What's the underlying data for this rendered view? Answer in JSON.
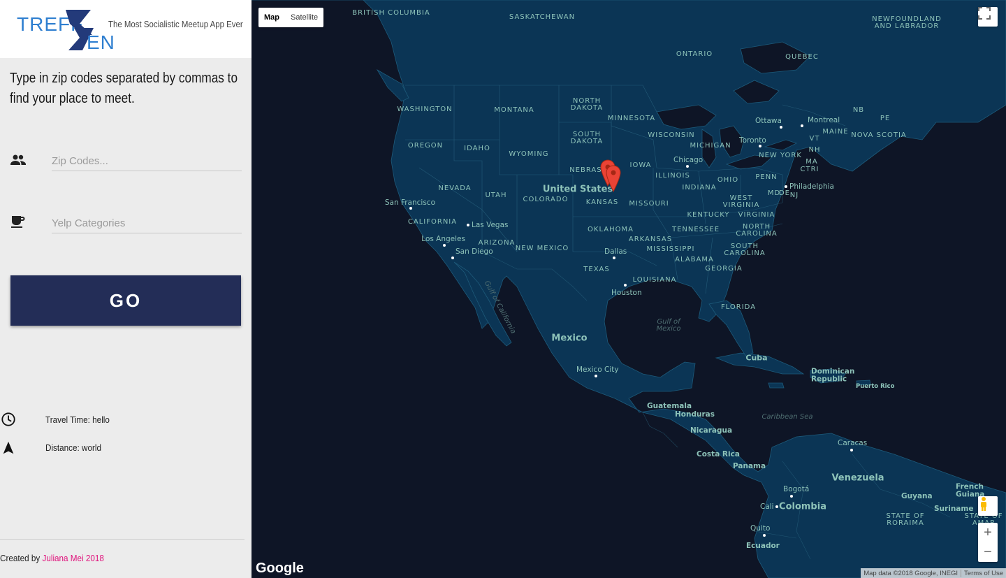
{
  "app": {
    "logo_text_top": "TREFF",
    "logo_text_bottom": "EN",
    "tagline": "The Most Socialistic Meetup App Ever"
  },
  "intro": "Type in zip codes separated by commas to find your place to meet.",
  "inputs": {
    "zip_placeholder": "Zip Codes...",
    "yelp_placeholder": "Yelp Categories"
  },
  "go_label": "GO",
  "stats": {
    "travel_time": "Travel Time: hello",
    "distance": "Distance: world"
  },
  "footer": {
    "prefix": "Created by ",
    "author": "Juliana Mei 2018"
  },
  "map": {
    "type_buttons": [
      "Map",
      "Satellite"
    ],
    "labels": {
      "countries": [
        "United States",
        "Mexico",
        "Cuba",
        "Venezuela",
        "Colombia"
      ],
      "regions": [
        "BRITISH COLUMBIA",
        "SASKATCHEWAN",
        "NEWFOUNDLAND AND LABRADOR",
        "ONTARIO",
        "QUEBEC",
        "WASHINGTON",
        "MONTANA",
        "NORTH DAKOTA",
        "MINNESOTA",
        "OREGON",
        "IDAHO",
        "WYOMING",
        "SOUTH DAKOTA",
        "WISCONSIN",
        "MICHIGAN",
        "NEBRASKA",
        "IOWA",
        "ILLINOIS",
        "INDIANA",
        "OHIO",
        "PENN",
        "NEW YORK",
        "NEVADA",
        "UTAH",
        "COLORADO",
        "KANSAS",
        "MISSOURI",
        "KENTUCKY",
        "WEST VIRGINIA",
        "VIRGINIA",
        "CALIFORNIA",
        "ARIZONA",
        "NEW MEXICO",
        "OKLAHOMA",
        "ARKANSAS",
        "TENNESSEE",
        "NORTH CAROLINA",
        "SOUTH CAROLINA",
        "TEXAS",
        "MISSISSIPPI",
        "ALABAMA",
        "GEORGIA",
        "LOUISIANA",
        "FLORIDA",
        "NB",
        "PE",
        "NOVA SCOTIA",
        "VT",
        "MAINE",
        "NH",
        "MA",
        "CTRI",
        "MD",
        "DE",
        "NJ",
        "STATE OF RORAIMA",
        "STATE OF AMAP"
      ],
      "cities": [
        "San Francisco",
        "Las Vegas",
        "Los Angeles",
        "San Diego",
        "Dallas",
        "Houston",
        "Chicago",
        "Toronto",
        "Ottawa",
        "Montreal",
        "Philadelphia",
        "Mexico City",
        "Guatemala",
        "Honduras",
        "Nicaragua",
        "Costa Rica",
        "Panama",
        "Dominican Republic",
        "Puerto Rico",
        "Caracas",
        "Bogotá",
        "Cali",
        "Quito",
        "Ecuador",
        "Guyana",
        "Suriname",
        "French Guiana"
      ],
      "waters": [
        "Gulf of Mexico",
        "Caribbean Sea",
        "Gulf of California"
      ]
    },
    "attribution": "Map data ©2018 Google, INEGI",
    "terms": "Terms of Use",
    "brand": "Google"
  }
}
